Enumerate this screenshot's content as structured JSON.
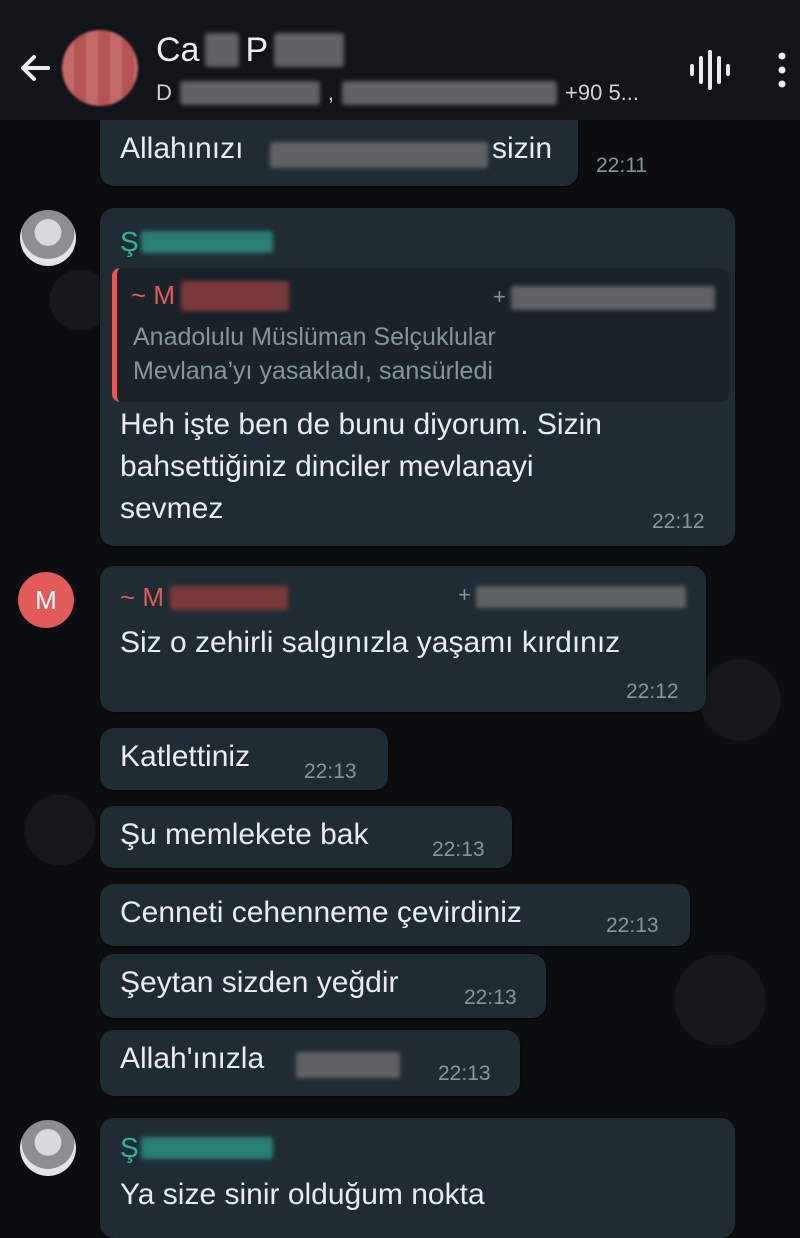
{
  "header": {
    "contact_name_start": "Ca",
    "contact_name_mid": "P",
    "subtitle_start": "D",
    "subtitle_sep": ",",
    "subtitle_phone": "+90 5..."
  },
  "icons": {
    "back": "arrow-left-icon",
    "call": "voice-call-icon",
    "more": "more-vertical-icon"
  },
  "messages": [
    {
      "text_start": "Allahınızı",
      "text_end": "sizin",
      "time": "22:11"
    },
    {
      "sender_initial": "Ş",
      "quote_author": "~ M",
      "quote_plus": "+",
      "quote_line1": "Anadolulu Müslüman Selçuklular",
      "quote_line2": "Mevlana’yı yasakladı, sansürledi",
      "line1": "Heh işte ben de bunu diyorum. Sizin",
      "line2": "bahsettiğiniz dinciler mevlanayi",
      "line3": "sevmez",
      "time": "22:12"
    },
    {
      "avatar_letter": "M",
      "sender_name": "~ M",
      "sender_plus": "+",
      "text": "Siz o zehirli salgınızla yaşamı kırdınız",
      "time": "22:12"
    },
    {
      "text": "Katlettiniz",
      "time": "22:13"
    },
    {
      "text": "Şu memlekete bak",
      "time": "22:13"
    },
    {
      "text": "Cenneti cehenneme çevirdiniz",
      "time": "22:13"
    },
    {
      "text": "Şeytan sizden yeğdir",
      "time": "22:13"
    },
    {
      "text": "Allah'ınızla",
      "time": "22:13"
    },
    {
      "sender_initial": "Ş",
      "text": "Ya size sinir olduğum nokta"
    }
  ],
  "colors": {
    "background": "#0b0d0f",
    "header": "#111418",
    "bubble": "#202c33",
    "sender_teal": "#2fb4a0",
    "quote_red": "#e35a5a",
    "timestamp": "#8696a0"
  }
}
